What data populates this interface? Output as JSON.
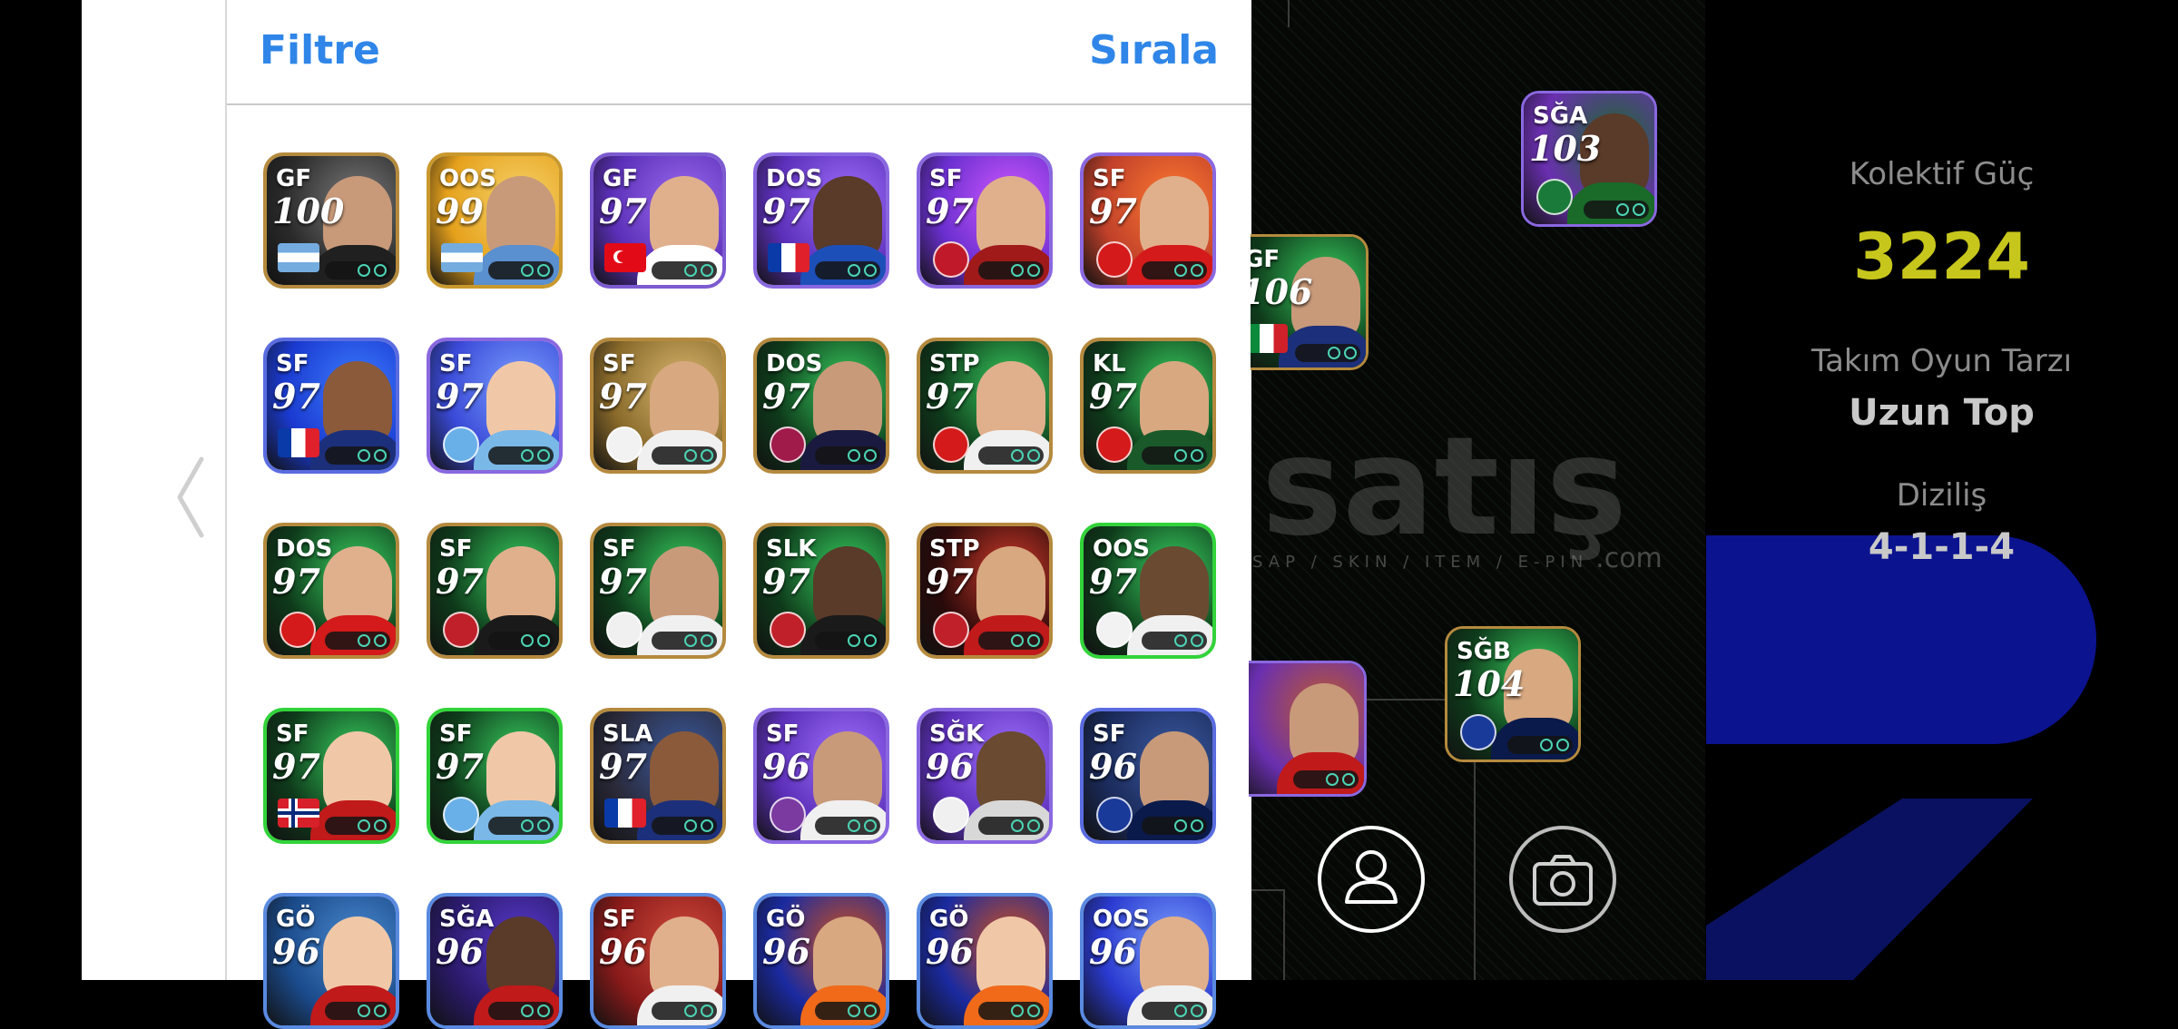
{
  "header": {
    "filter_label": "Filtre",
    "sort_label": "Sırala"
  },
  "cards": [
    {
      "pos": "GF",
      "rating": "100",
      "bg": "#2a2a2a",
      "accent": "#7a7a7a",
      "border": "#b58a3e",
      "skin": "#c89a7a",
      "kit": "#202020",
      "badge": "flag-argentina"
    },
    {
      "pos": "OOS",
      "rating": "99",
      "bg": "#e6a11c",
      "accent": "#f6d36a",
      "border": "#c9992e",
      "skin": "#c89a7a",
      "kit": "#5a8fd0",
      "badge": "flag-argentina"
    },
    {
      "pos": "GF",
      "rating": "97",
      "bg": "#5b2fb8",
      "accent": "#9c6cf0",
      "border": "#7c5ad0",
      "skin": "#e0b08c",
      "kit": "#ffffff",
      "badge": "flag-turkey"
    },
    {
      "pos": "DOS",
      "rating": "97",
      "bg": "#5b2fb8",
      "accent": "#a070ff",
      "border": "#8a68e0",
      "skin": "#5a3a28",
      "kit": "#1d4fb8",
      "badge": "flag-france"
    },
    {
      "pos": "SF",
      "rating": "97",
      "bg": "#6a2fd0",
      "accent": "#d058ff",
      "border": "#8a68e0",
      "skin": "#e0b08c",
      "kit": "#a01a1a",
      "badge": "crest-club"
    },
    {
      "pos": "SF",
      "rating": "97",
      "bg": "#c0402a",
      "accent": "#ff7a30",
      "border": "#8a68e0",
      "skin": "#e0b08c",
      "kit": "#d41a1a",
      "badge": "crest-arsenal"
    },
    {
      "pos": "SF",
      "rating": "97",
      "bg": "#1a3ad0",
      "accent": "#3c7cff",
      "border": "#5a6ce0",
      "skin": "#8a5a3a",
      "kit": "#1c2f7a",
      "badge": "flag-france"
    },
    {
      "pos": "SF",
      "rating": "97",
      "bg": "#3a4ad8",
      "accent": "#7aa0ff",
      "border": "#8a68e0",
      "skin": "#f0c8a8",
      "kit": "#7ab8e8",
      "badge": "crest-city"
    },
    {
      "pos": "SF",
      "rating": "97",
      "bg": "#8a6a2a",
      "accent": "#d8b870",
      "border": "#b58a3e",
      "skin": "#d8a880",
      "kit": "#f0f0f0",
      "badge": "crest-madrid"
    },
    {
      "pos": "DOS",
      "rating": "97",
      "bg": "#0e3a1a",
      "accent": "#38d060",
      "border": "#b58a3e",
      "skin": "#c89a7a",
      "kit": "#1a1a40",
      "badge": "crest-barca"
    },
    {
      "pos": "STP",
      "rating": "97",
      "bg": "#0e3a1a",
      "accent": "#38d060",
      "border": "#b58a3e",
      "skin": "#e0b08c",
      "kit": "#f0f0f0",
      "badge": "crest-arsenal"
    },
    {
      "pos": "KL",
      "rating": "97",
      "bg": "#0e3a1a",
      "accent": "#38d060",
      "border": "#b58a3e",
      "skin": "#d8a880",
      "kit": "#1a5a2a",
      "badge": "crest-arsenal"
    },
    {
      "pos": "DOS",
      "rating": "97",
      "bg": "#0e3a1a",
      "accent": "#38d060",
      "border": "#b58a3e",
      "skin": "#e0b08c",
      "kit": "#d41a1a",
      "badge": "crest-arsenal"
    },
    {
      "pos": "SF",
      "rating": "97",
      "bg": "#0e3a1a",
      "accent": "#38d060",
      "border": "#b58a3e",
      "skin": "#e0b08c",
      "kit": "#1a1a1a",
      "badge": "crest-flamengo"
    },
    {
      "pos": "SF",
      "rating": "97",
      "bg": "#0e3a1a",
      "accent": "#38d060",
      "border": "#b58a3e",
      "skin": "#c89a7a",
      "kit": "#f0f0f0",
      "badge": "crest-santos"
    },
    {
      "pos": "SLK",
      "rating": "97",
      "bg": "#0e3a1a",
      "accent": "#38d060",
      "border": "#b58a3e",
      "skin": "#5a3a28",
      "kit": "#1a1a1a",
      "badge": "crest-flamengo"
    },
    {
      "pos": "STP",
      "rating": "97",
      "bg": "#2a0a0a",
      "accent": "#d03a2a",
      "border": "#b58a3e",
      "skin": "#d8a880",
      "kit": "#c01a1a",
      "badge": "crest-milan"
    },
    {
      "pos": "OOS",
      "rating": "97",
      "bg": "#0e3a1a",
      "accent": "#38d060",
      "border": "#32d33a",
      "skin": "#6a4a30",
      "kit": "#f0f0f0",
      "badge": "crest-madrid"
    },
    {
      "pos": "SF",
      "rating": "97",
      "bg": "#0e3a1a",
      "accent": "#38d060",
      "border": "#32d33a",
      "skin": "#f0c8a8",
      "kit": "#c01a1a",
      "badge": "flag-norway"
    },
    {
      "pos": "SF",
      "rating": "97",
      "bg": "#0e3a1a",
      "accent": "#38d060",
      "border": "#32d33a",
      "skin": "#f0c8a8",
      "kit": "#7ab8e8",
      "badge": "crest-city"
    },
    {
      "pos": "SLA",
      "rating": "97",
      "bg": "#2a2a3a",
      "accent": "#3a5aa0",
      "border": "#b58a3e",
      "skin": "#8a5a3a",
      "kit": "#1c2f7a",
      "badge": "flag-france"
    },
    {
      "pos": "SF",
      "rating": "96",
      "bg": "#5b2fb8",
      "accent": "#a070ff",
      "border": "#8a68e0",
      "skin": "#c89a7a",
      "kit": "#f0f0f0",
      "badge": "crest-valladolid"
    },
    {
      "pos": "SĞK",
      "rating": "96",
      "bg": "#5b2fb8",
      "accent": "#a070ff",
      "border": "#8a68e0",
      "skin": "#6a4a30",
      "kit": "#d8d8d8",
      "badge": "crest-spfc"
    },
    {
      "pos": "SF",
      "rating": "96",
      "bg": "#1a2a5a",
      "accent": "#3a5aa0",
      "border": "#5a6ce0",
      "skin": "#c89a7a",
      "kit": "#0a1a4a",
      "badge": "crest-inter"
    },
    {
      "pos": "GÖ",
      "rating": "96",
      "bg": "#1a4a8a",
      "accent": "#4a8ad0",
      "border": "#5a8ae0",
      "skin": "#f0c8a8",
      "kit": "#c01a1a",
      "badge": "none"
    },
    {
      "pos": "SĞA",
      "rating": "96",
      "bg": "#2a1a6a",
      "accent": "#5a3ad0",
      "border": "#5a8ae0",
      "skin": "#5a3a28",
      "kit": "#c01a1a",
      "badge": "none"
    },
    {
      "pos": "SF",
      "rating": "96",
      "bg": "#8a1a1a",
      "accent": "#d04a3a",
      "border": "#5a8ae0",
      "skin": "#e0b08c",
      "kit": "#f0f0f0",
      "badge": "none"
    },
    {
      "pos": "GÖ",
      "rating": "96",
      "bg": "#1a2aa0",
      "accent": "#d0501a",
      "border": "#5a8ae0",
      "skin": "#d8a880",
      "kit": "#f06a1a",
      "badge": "none"
    },
    {
      "pos": "GÖ",
      "rating": "96",
      "bg": "#1a2aa0",
      "accent": "#d0501a",
      "border": "#5a8ae0",
      "skin": "#f0c8a8",
      "kit": "#f06a1a",
      "badge": "none"
    },
    {
      "pos": "OOS",
      "rating": "96",
      "bg": "#2a3ad0",
      "accent": "#7aa0ff",
      "border": "#5a8ae0",
      "skin": "#e0b08c",
      "kit": "#f0f0f0",
      "badge": "none"
    }
  ],
  "pitch_cards": [
    {
      "pos": "SĞA",
      "rating": "103",
      "bg": "#6a2fb0",
      "accent": "#1a6a2a",
      "skin": "#5a3a28",
      "kit": "#1a6a2a",
      "badge": "crest-palmeiras",
      "border": "#8a68e0"
    },
    {
      "pos": "GF",
      "rating": "106",
      "bg": "#0e3a1a",
      "accent": "#38d060",
      "skin": "#c89a7a",
      "kit": "#1c2f7a",
      "badge": "flag-italy",
      "border": "#b58a3e"
    },
    {
      "pos": "SĞB",
      "rating": "104",
      "bg": "#0e3a1a",
      "accent": "#38d060",
      "skin": "#d8a880",
      "kit": "#0a1a4a",
      "badge": "crest-inter",
      "border": "#b58a3e"
    },
    {
      "pos": "",
      "rating": "",
      "bg": "#6a2fb0",
      "accent": "#c05a2a",
      "skin": "#c89a7a",
      "kit": "#c01a1a",
      "badge": "none",
      "border": "#8a68e0"
    }
  ],
  "sidebar": {
    "collective_power_label": "Kolektif Güç",
    "collective_power_value": "3224",
    "play_style_label": "Takım Oyun Tarzı",
    "play_style_value": "Uzun Top",
    "formation_label": "Diziliş",
    "formation_value": "4-1-1-4"
  },
  "watermark": {
    "text": "satış",
    "sub": "SAP / SKIN / ITEM / E-PIN",
    "com": ".com"
  },
  "icons": {
    "back": "chevron-left-icon",
    "profile": "user-icon",
    "camera": "camera-icon"
  }
}
